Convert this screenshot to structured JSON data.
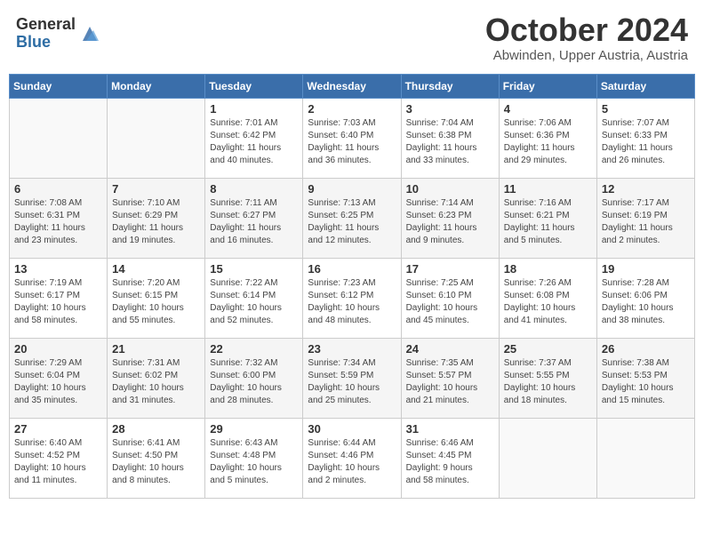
{
  "header": {
    "logo_general": "General",
    "logo_blue": "Blue",
    "month": "October 2024",
    "location": "Abwinden, Upper Austria, Austria"
  },
  "weekdays": [
    "Sunday",
    "Monday",
    "Tuesday",
    "Wednesday",
    "Thursday",
    "Friday",
    "Saturday"
  ],
  "weeks": [
    [
      {
        "day": "",
        "info": ""
      },
      {
        "day": "",
        "info": ""
      },
      {
        "day": "1",
        "info": "Sunrise: 7:01 AM\nSunset: 6:42 PM\nDaylight: 11 hours\nand 40 minutes."
      },
      {
        "day": "2",
        "info": "Sunrise: 7:03 AM\nSunset: 6:40 PM\nDaylight: 11 hours\nand 36 minutes."
      },
      {
        "day": "3",
        "info": "Sunrise: 7:04 AM\nSunset: 6:38 PM\nDaylight: 11 hours\nand 33 minutes."
      },
      {
        "day": "4",
        "info": "Sunrise: 7:06 AM\nSunset: 6:36 PM\nDaylight: 11 hours\nand 29 minutes."
      },
      {
        "day": "5",
        "info": "Sunrise: 7:07 AM\nSunset: 6:33 PM\nDaylight: 11 hours\nand 26 minutes."
      }
    ],
    [
      {
        "day": "6",
        "info": "Sunrise: 7:08 AM\nSunset: 6:31 PM\nDaylight: 11 hours\nand 23 minutes."
      },
      {
        "day": "7",
        "info": "Sunrise: 7:10 AM\nSunset: 6:29 PM\nDaylight: 11 hours\nand 19 minutes."
      },
      {
        "day": "8",
        "info": "Sunrise: 7:11 AM\nSunset: 6:27 PM\nDaylight: 11 hours\nand 16 minutes."
      },
      {
        "day": "9",
        "info": "Sunrise: 7:13 AM\nSunset: 6:25 PM\nDaylight: 11 hours\nand 12 minutes."
      },
      {
        "day": "10",
        "info": "Sunrise: 7:14 AM\nSunset: 6:23 PM\nDaylight: 11 hours\nand 9 minutes."
      },
      {
        "day": "11",
        "info": "Sunrise: 7:16 AM\nSunset: 6:21 PM\nDaylight: 11 hours\nand 5 minutes."
      },
      {
        "day": "12",
        "info": "Sunrise: 7:17 AM\nSunset: 6:19 PM\nDaylight: 11 hours\nand 2 minutes."
      }
    ],
    [
      {
        "day": "13",
        "info": "Sunrise: 7:19 AM\nSunset: 6:17 PM\nDaylight: 10 hours\nand 58 minutes."
      },
      {
        "day": "14",
        "info": "Sunrise: 7:20 AM\nSunset: 6:15 PM\nDaylight: 10 hours\nand 55 minutes."
      },
      {
        "day": "15",
        "info": "Sunrise: 7:22 AM\nSunset: 6:14 PM\nDaylight: 10 hours\nand 52 minutes."
      },
      {
        "day": "16",
        "info": "Sunrise: 7:23 AM\nSunset: 6:12 PM\nDaylight: 10 hours\nand 48 minutes."
      },
      {
        "day": "17",
        "info": "Sunrise: 7:25 AM\nSunset: 6:10 PM\nDaylight: 10 hours\nand 45 minutes."
      },
      {
        "day": "18",
        "info": "Sunrise: 7:26 AM\nSunset: 6:08 PM\nDaylight: 10 hours\nand 41 minutes."
      },
      {
        "day": "19",
        "info": "Sunrise: 7:28 AM\nSunset: 6:06 PM\nDaylight: 10 hours\nand 38 minutes."
      }
    ],
    [
      {
        "day": "20",
        "info": "Sunrise: 7:29 AM\nSunset: 6:04 PM\nDaylight: 10 hours\nand 35 minutes."
      },
      {
        "day": "21",
        "info": "Sunrise: 7:31 AM\nSunset: 6:02 PM\nDaylight: 10 hours\nand 31 minutes."
      },
      {
        "day": "22",
        "info": "Sunrise: 7:32 AM\nSunset: 6:00 PM\nDaylight: 10 hours\nand 28 minutes."
      },
      {
        "day": "23",
        "info": "Sunrise: 7:34 AM\nSunset: 5:59 PM\nDaylight: 10 hours\nand 25 minutes."
      },
      {
        "day": "24",
        "info": "Sunrise: 7:35 AM\nSunset: 5:57 PM\nDaylight: 10 hours\nand 21 minutes."
      },
      {
        "day": "25",
        "info": "Sunrise: 7:37 AM\nSunset: 5:55 PM\nDaylight: 10 hours\nand 18 minutes."
      },
      {
        "day": "26",
        "info": "Sunrise: 7:38 AM\nSunset: 5:53 PM\nDaylight: 10 hours\nand 15 minutes."
      }
    ],
    [
      {
        "day": "27",
        "info": "Sunrise: 6:40 AM\nSunset: 4:52 PM\nDaylight: 10 hours\nand 11 minutes."
      },
      {
        "day": "28",
        "info": "Sunrise: 6:41 AM\nSunset: 4:50 PM\nDaylight: 10 hours\nand 8 minutes."
      },
      {
        "day": "29",
        "info": "Sunrise: 6:43 AM\nSunset: 4:48 PM\nDaylight: 10 hours\nand 5 minutes."
      },
      {
        "day": "30",
        "info": "Sunrise: 6:44 AM\nSunset: 4:46 PM\nDaylight: 10 hours\nand 2 minutes."
      },
      {
        "day": "31",
        "info": "Sunrise: 6:46 AM\nSunset: 4:45 PM\nDaylight: 9 hours\nand 58 minutes."
      },
      {
        "day": "",
        "info": ""
      },
      {
        "day": "",
        "info": ""
      }
    ]
  ]
}
